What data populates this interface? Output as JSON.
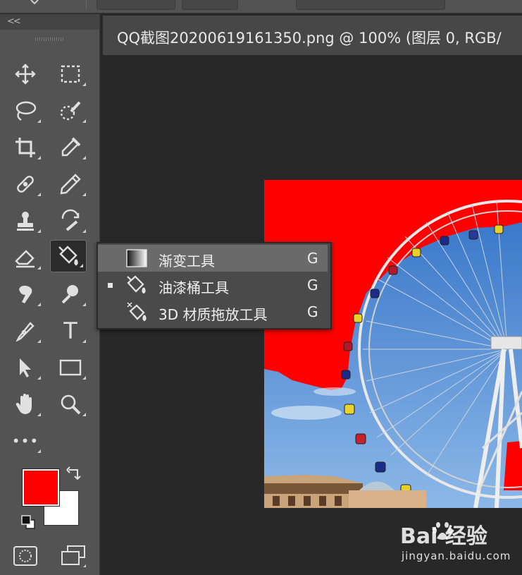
{
  "document": {
    "tab_title": "QQ截图20200619161350.png @ 100% (图层 0, RGB/"
  },
  "toolbar": {
    "collapse_label": "<<",
    "tools": [
      {
        "id": "move",
        "icon": "move-icon"
      },
      {
        "id": "marquee",
        "icon": "rect-marquee-icon"
      },
      {
        "id": "lasso",
        "icon": "lasso-icon"
      },
      {
        "id": "quick-select",
        "icon": "quick-select-icon"
      },
      {
        "id": "crop",
        "icon": "crop-icon"
      },
      {
        "id": "eyedropper",
        "icon": "eyedropper-icon"
      },
      {
        "id": "healing",
        "icon": "healing-brush-icon"
      },
      {
        "id": "brush",
        "icon": "pencil-icon"
      },
      {
        "id": "stamp",
        "icon": "clone-stamp-icon"
      },
      {
        "id": "history-brush",
        "icon": "history-brush-icon"
      },
      {
        "id": "eraser",
        "icon": "eraser-icon"
      },
      {
        "id": "paint-bucket",
        "icon": "paint-bucket-icon"
      },
      {
        "id": "smudge",
        "icon": "smudge-icon"
      },
      {
        "id": "dodge",
        "icon": "dodge-icon"
      },
      {
        "id": "pen",
        "icon": "pen-icon"
      },
      {
        "id": "type",
        "icon": "type-icon"
      },
      {
        "id": "path-select",
        "icon": "path-select-icon"
      },
      {
        "id": "rectangle",
        "icon": "rectangle-icon"
      },
      {
        "id": "hand",
        "icon": "hand-icon"
      },
      {
        "id": "zoom",
        "icon": "zoom-icon"
      },
      {
        "id": "more",
        "icon": "more-icon"
      }
    ],
    "type_glyph": "T",
    "more_glyph": "•••",
    "foreground_color": "#ff0000",
    "background_color": "#ffffff"
  },
  "flyout_menu": {
    "items": [
      {
        "label": "渐变工具",
        "shortcut": "G",
        "selected": false,
        "highlighted": true,
        "icon": "gradient-icon"
      },
      {
        "label": "油漆桶工具",
        "shortcut": "G",
        "selected": true,
        "highlighted": false,
        "icon": "paint-bucket-icon"
      },
      {
        "label": "3D 材质拖放工具",
        "shortcut": "G",
        "selected": false,
        "highlighted": false,
        "icon": "3d-material-drop-icon"
      }
    ]
  },
  "watermark": {
    "brand": "Bai 经验",
    "url": "jingyan.baidu.com"
  },
  "colors": {
    "panel": "#535353",
    "canvas_bg": "#282828",
    "fill_red": "#ff0000",
    "sky_blue": "#4a8fd6"
  }
}
